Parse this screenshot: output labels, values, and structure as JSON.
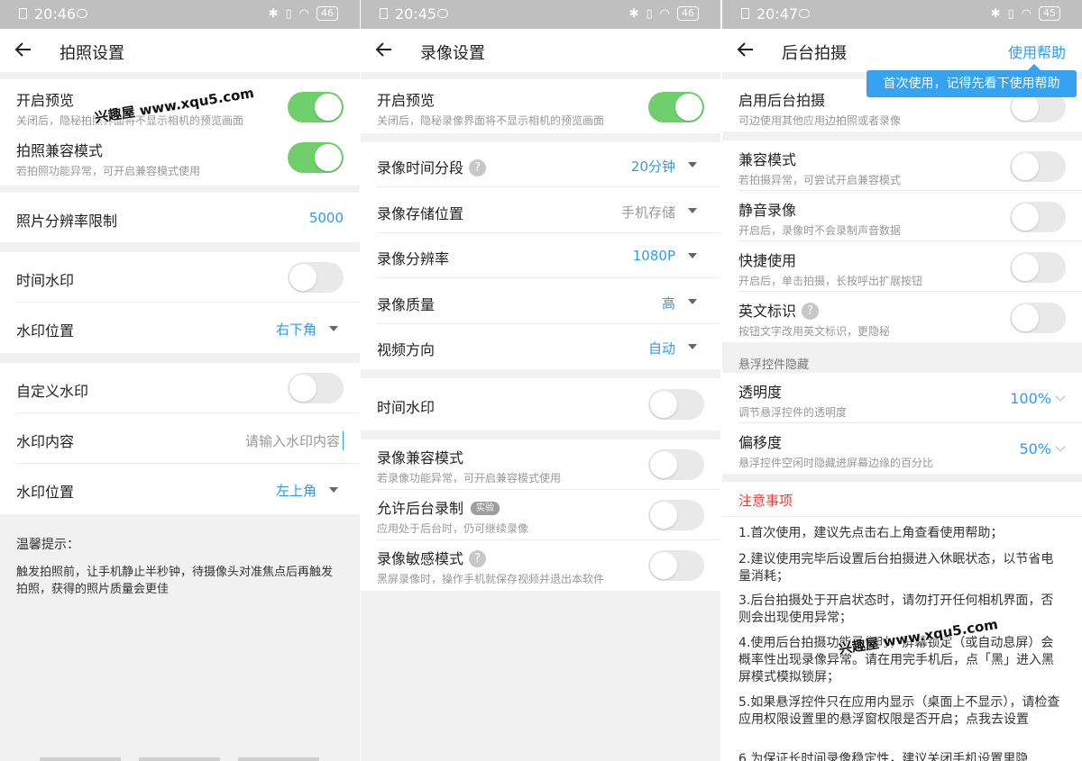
{
  "watermark": "兴趣屋 www.xqu5.com",
  "panel1": {
    "status": {
      "time": "20:46",
      "battery": "46"
    },
    "title": "拍照设置",
    "preview": {
      "label": "开启预览",
      "desc": "关闭后，隐秘拍照界面将不显示相机的预览画面"
    },
    "compat": {
      "label": "拍照兼容模式",
      "desc": "若拍照功能异常，可开启兼容模式使用"
    },
    "resolution": {
      "label": "照片分辨率限制",
      "value": "5000"
    },
    "time_wm": {
      "label": "时间水印"
    },
    "wm_pos1": {
      "label": "水印位置",
      "value": "右下角"
    },
    "custom_wm": {
      "label": "自定义水印"
    },
    "wm_content": {
      "label": "水印内容",
      "placeholder": "请输入水印内容"
    },
    "wm_pos2": {
      "label": "水印位置",
      "value": "左上角"
    },
    "tip_title": "温馨提示：",
    "tip_text": "触发拍照前，让手机静止半秒钟，待摄像头对准焦点后再触发拍照，获得的照片质量会更佳"
  },
  "panel2": {
    "status": {
      "time": "20:45",
      "battery": "46"
    },
    "title": "录像设置",
    "preview": {
      "label": "开启预览",
      "desc": "关闭后，隐秘录像界面将不显示相机的预览画面"
    },
    "segment": {
      "label": "录像时间分段",
      "value": "20分钟"
    },
    "storage": {
      "label": "录像存储位置",
      "value": "手机存储"
    },
    "resolution": {
      "label": "录像分辨率",
      "value": "1080P"
    },
    "quality": {
      "label": "录像质量",
      "value": "高"
    },
    "orientation": {
      "label": "视频方向",
      "value": "自动"
    },
    "time_wm": {
      "label": "时间水印"
    },
    "compat": {
      "label": "录像兼容模式",
      "desc": "若录像功能异常，可开启兼容模式使用"
    },
    "bg_record": {
      "label": "允许后台录制",
      "tag": "实验",
      "desc": "应用处于后台时，仍可继续录像"
    },
    "sensitive": {
      "label": "录像敏感模式",
      "desc": "黑屏录像时，操作手机就保存视频并退出本软件"
    }
  },
  "panel3": {
    "status": {
      "time": "20:47",
      "battery": "45"
    },
    "title": "后台拍摄",
    "help": "使用帮助",
    "tooltip": "首次使用，记得先看下使用帮助",
    "enable": {
      "label": "启用后台拍摄",
      "desc": "可边使用其他应用边拍照或者录像"
    },
    "compat": {
      "label": "兼容模式",
      "desc": "若拍摄异常，可尝试开启兼容模式"
    },
    "mute": {
      "label": "静音录像",
      "desc": "开启后，录像时不会录制声音数据"
    },
    "quick": {
      "label": "快捷使用",
      "desc": "开启后，单击拍摄，长按呼出扩展按钮"
    },
    "english": {
      "label": "英文标识",
      "desc": "按钮文字改用英文标识，更隐秘"
    },
    "float_header": "悬浮控件隐藏",
    "opacity": {
      "label": "透明度",
      "desc": "调节悬浮控件的透明度",
      "value": "100%"
    },
    "offset": {
      "label": "偏移度",
      "desc": "悬浮控件空闲时隐藏进屏幕边缘的百分比",
      "value": "50%"
    },
    "notes_title": "注意事项",
    "notes": [
      "1.首次使用，建议先点击右上角查看使用帮助；",
      "2.建议使用完毕后设置后台拍摄进入休眠状态，以节省电量消耗；",
      "3.后台拍摄处于开启状态时，请勿打开任何相机界面，否则会出现使用异常；",
      "4.使用后台拍摄功能录像时，屏幕锁定（或自动息屏）会概率性出现录像异常。请在用完手机后，点「黑」进入黑屏模式模拟锁屏；",
      "5.如果悬浮控件只在应用内显示（桌面上不显示），请检查应用权限设置里的悬浮窗权限是否开启；点我去设置",
      "6.为保证长时间录像稳定性，建议关闭手机设置里隐"
    ]
  },
  "colors": {
    "accent": "#2f9be8",
    "toggle_on": "#6fd06b",
    "notes_title": "#e53935",
    "tooltip": "#35a3ef"
  }
}
